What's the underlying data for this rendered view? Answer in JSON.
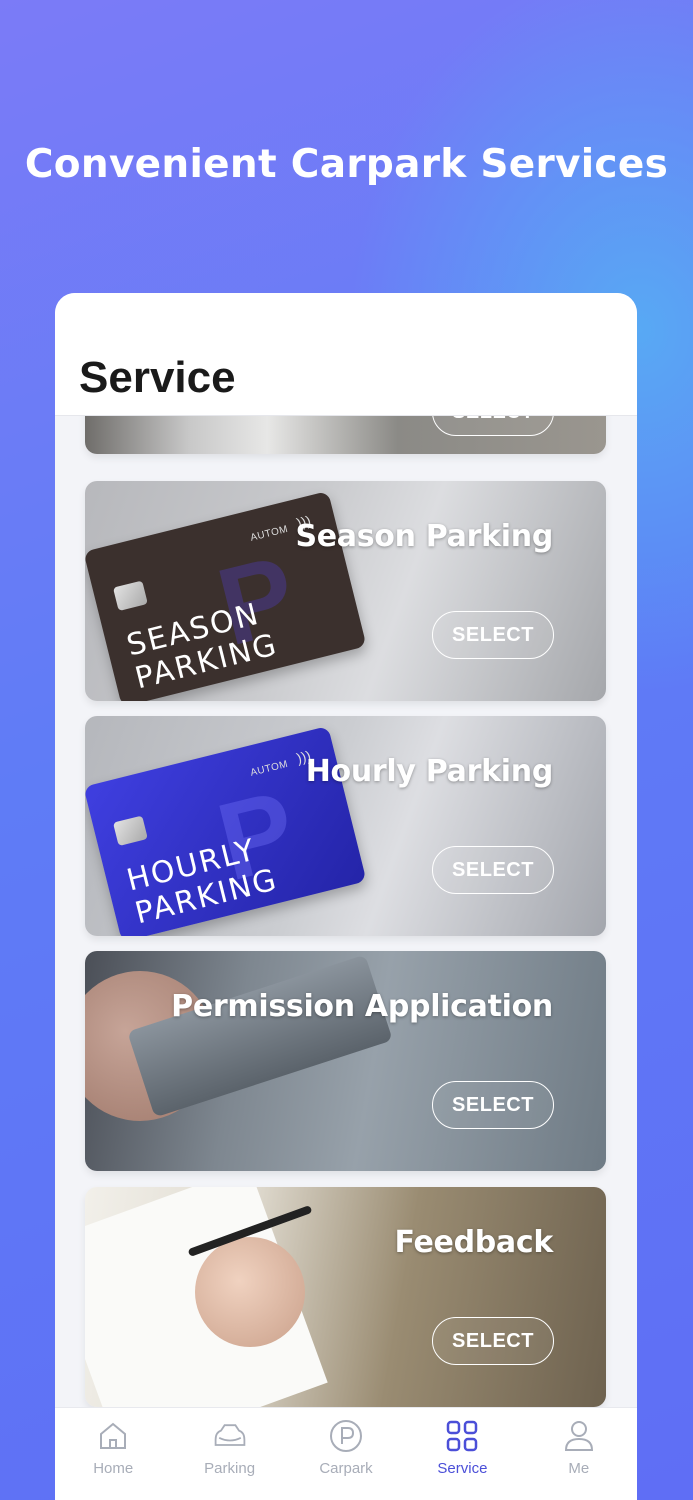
{
  "headline": "Convenient Carpark Services",
  "page_title": "Service",
  "cards": [
    {
      "title": "",
      "button": "SELECT"
    },
    {
      "title": "Season Parking",
      "button": "SELECT",
      "pass_text": [
        "SEASON",
        "PARKING"
      ],
      "brand": "AUTOM"
    },
    {
      "title": "Hourly Parking",
      "button": "SELECT",
      "pass_text": [
        "HOURLY",
        "PARKING"
      ],
      "brand": "AUTOM"
    },
    {
      "title": "Permission Application",
      "button": "SELECT"
    },
    {
      "title": "Feedback",
      "button": "SELECT"
    }
  ],
  "tabs": [
    {
      "label": "Home",
      "icon": "home-icon"
    },
    {
      "label": "Parking",
      "icon": "car-icon"
    },
    {
      "label": "Carpark",
      "icon": "parking-p-icon"
    },
    {
      "label": "Service",
      "icon": "grid-icon",
      "active": true
    },
    {
      "label": "Me",
      "icon": "person-icon"
    }
  ],
  "colors": {
    "accent": "#4b4fd8",
    "inactive": "#a8adb8",
    "bg_top": "#7b7bf7"
  }
}
